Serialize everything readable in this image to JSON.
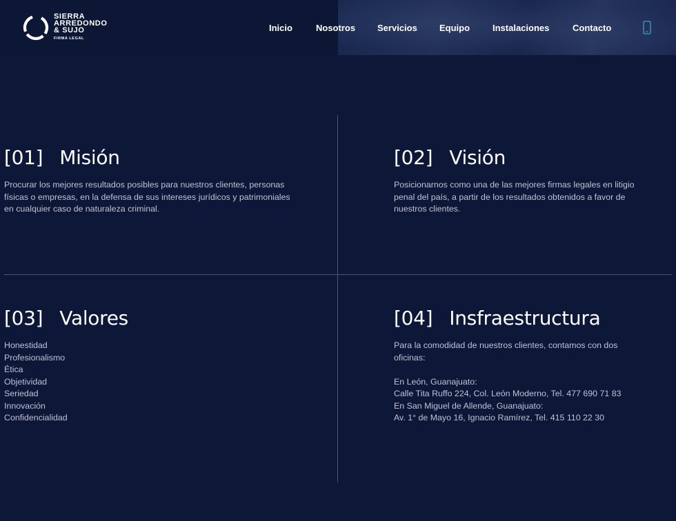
{
  "logo": {
    "lines": [
      "SIERRA",
      "ARREDONDO",
      "& SUJO"
    ],
    "sub": "FIRMA LEGAL"
  },
  "nav": {
    "items": [
      "Inicio",
      "Nosotros",
      "Servicios",
      "Equipo",
      "Instalaciones",
      "Contacto"
    ]
  },
  "colors": {
    "background": "#0d1737",
    "phone_icon": "#3aa3b8",
    "text": "#bec3d4",
    "heading": "#ffffff"
  },
  "sections": [
    {
      "number": "[01]",
      "title": "Misión",
      "body": [
        "Procurar los mejores resultados posibles para nuestros clientes, personas",
        "físicas o empresas, en la defensa de sus intereses jurídicos y patrimoniales",
        "en cualquier caso de naturaleza criminal."
      ]
    },
    {
      "number": "[02]",
      "title": "Visión",
      "body": [
        "Posicionarnos como una de las mejores firmas legales en litigio",
        "penal del país, a partir de los resultados obtenidos a favor de",
        "nuestros clientes."
      ]
    },
    {
      "number": "[03]",
      "title": "Valores",
      "body": [
        "Honestidad",
        "Profesionalismo",
        "Ética",
        "Objetividad",
        "Seriedad",
        "Innovación",
        "Confidencialidad"
      ]
    },
    {
      "number": "[04]",
      "title": "Insfraestructura",
      "body": [
        "Para la comodidad de nuestros clientes, contamos con dos",
        "oficinas:",
        "",
        "En León, Guanajuato:",
        "Calle Tita Ruffo 224, Col. León Moderno, Tel. 477 690 71 83",
        "En San Miguel de Allende, Guanajuato:",
        "Av. 1° de Mayo 16, Ignacio Ramírez, Tel. 415 110 22 30"
      ]
    }
  ]
}
